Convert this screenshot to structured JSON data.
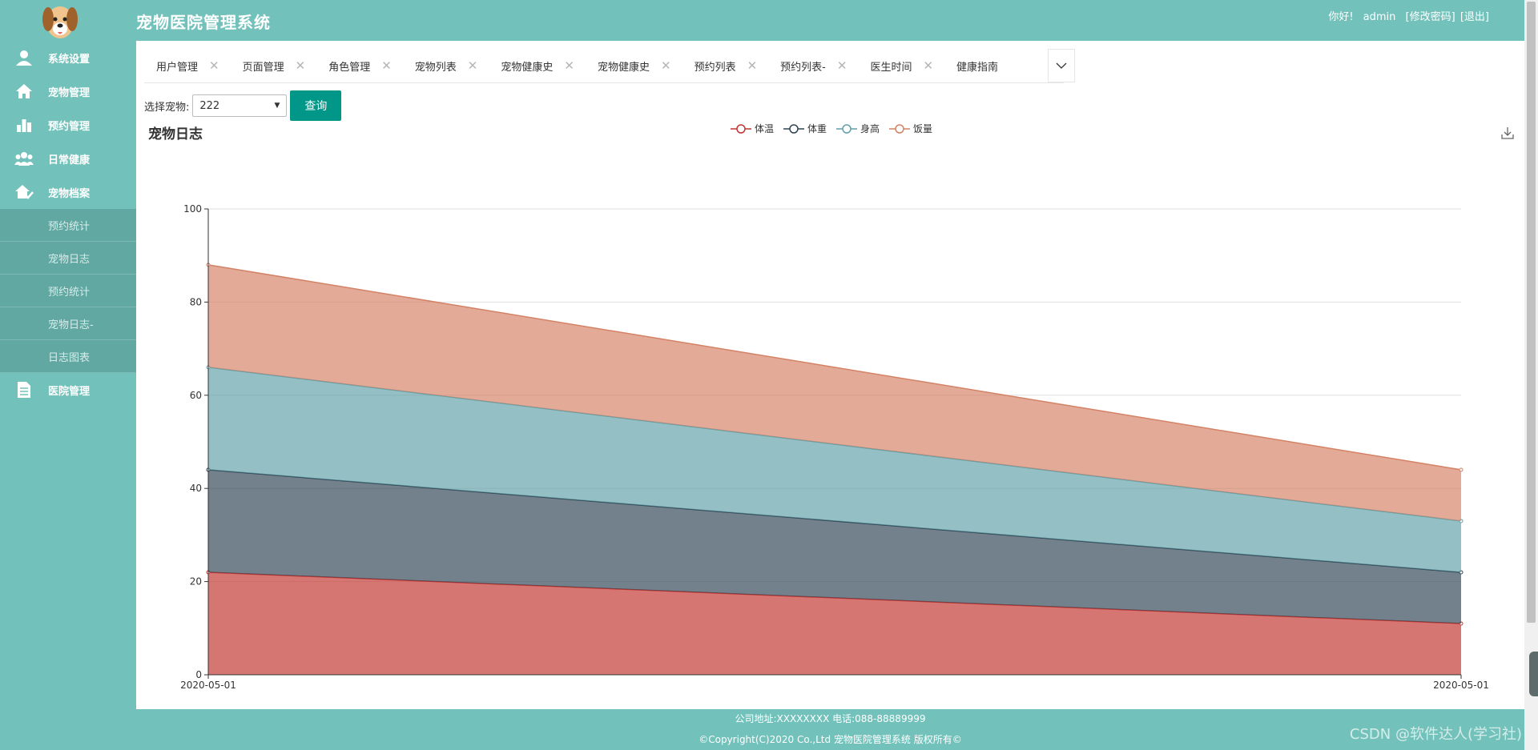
{
  "app": {
    "title": "宠物医院管理系统",
    "greeting": "你好!",
    "username": "admin",
    "change_password": "[修改密码]",
    "logout": "[退出]"
  },
  "sidebar": {
    "items": [
      {
        "label": "系统设置",
        "icon": "user-icon"
      },
      {
        "label": "宠物管理",
        "icon": "home-icon"
      },
      {
        "label": "预约管理",
        "icon": "bar-chart-icon"
      },
      {
        "label": "日常健康",
        "icon": "group-icon"
      },
      {
        "label": "宠物档案",
        "icon": "house-check-icon"
      }
    ],
    "subitems": [
      "预约统计",
      "宠物日志",
      "预约统计",
      "宠物日志-",
      "日志图表"
    ],
    "last_item": {
      "label": "医院管理",
      "icon": "document-icon"
    }
  },
  "tabs": [
    "用户管理",
    "页面管理",
    "角色管理",
    "宠物列表",
    "宠物健康史",
    "宠物健康史",
    "预约列表",
    "预约列表-",
    "医生时间",
    "健康指南"
  ],
  "toolbar": {
    "label": "选择宠物:",
    "selected_pet": "222",
    "query_button": "查询"
  },
  "chart": {
    "title": "宠物日志",
    "legend": [
      "体温",
      "体重",
      "身高",
      "饭量"
    ]
  },
  "chart_data": {
    "type": "area",
    "stacked": true,
    "categories": [
      "2020-05-01",
      "2020-05-01"
    ],
    "ylim": [
      0,
      100
    ],
    "yticks": [
      0,
      20,
      40,
      60,
      80,
      100
    ],
    "grid": true,
    "legend_position": "top-center",
    "series": [
      {
        "name": "体温",
        "values": [
          22,
          11
        ],
        "color": "#c23531"
      },
      {
        "name": "体重",
        "values": [
          22,
          11
        ],
        "color": "#2f4554"
      },
      {
        "name": "身高",
        "values": [
          22,
          11
        ],
        "color": "#61a0a8"
      },
      {
        "name": "饭量",
        "values": [
          22,
          11
        ],
        "color": "#d48265"
      }
    ]
  },
  "footer": {
    "line1": "公司地址:XXXXXXXX 电话:088-88889999",
    "line2": "©Copyright(C)2020 Co.,Ltd 宠物医院管理系统 版权所有©"
  },
  "watermark": "CSDN @软件达人(学习社)"
}
